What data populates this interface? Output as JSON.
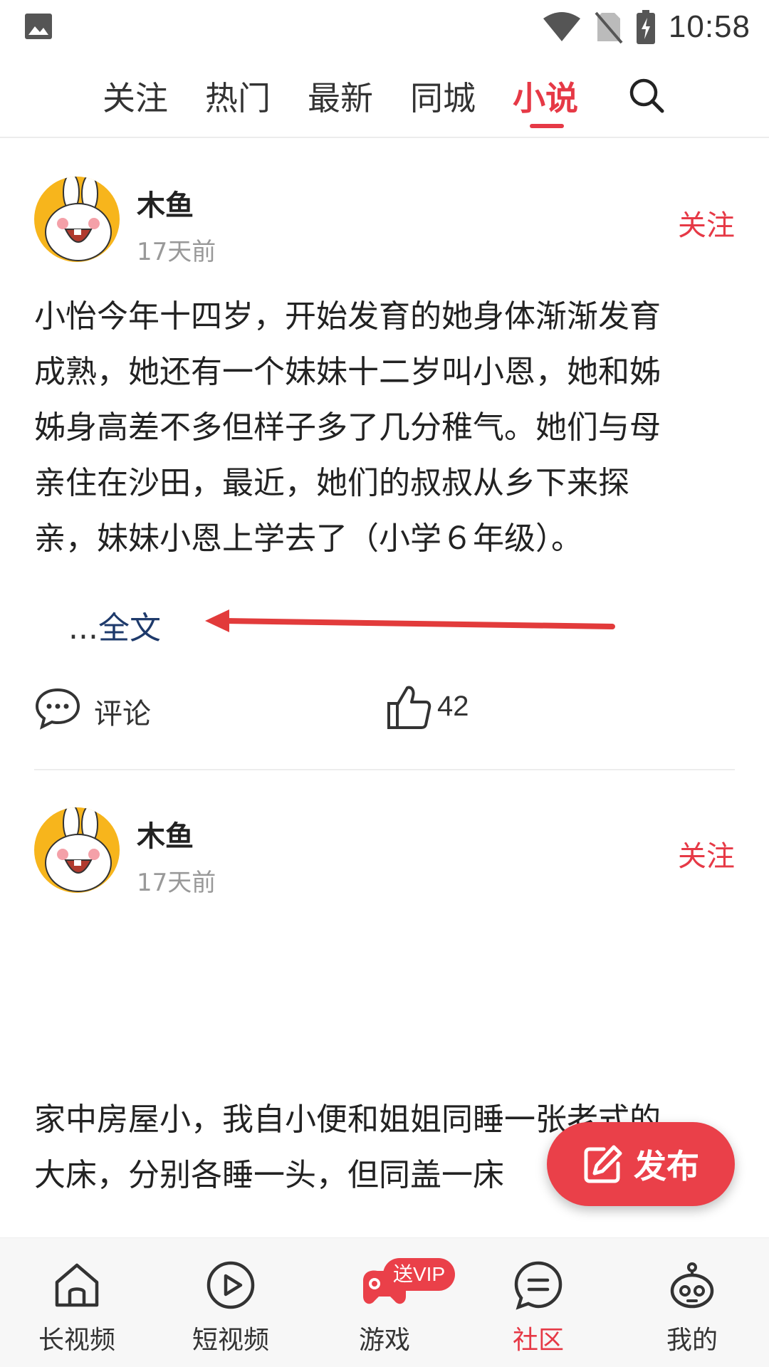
{
  "status_bar": {
    "time": "10:58",
    "icons": [
      "image-icon",
      "wifi-icon",
      "no-sim-icon",
      "battery-charging-icon"
    ]
  },
  "top_nav": {
    "tabs": [
      {
        "label": "关注"
      },
      {
        "label": "热门"
      },
      {
        "label": "最新"
      },
      {
        "label": "同城"
      },
      {
        "label": "小说"
      }
    ],
    "active_tab": "小说",
    "search_icon": "search-icon"
  },
  "posts": [
    {
      "author": "木鱼",
      "time": "17天前",
      "follow_label": "关注",
      "content_lines": [
        "小怡今年十四岁，开始发育的她身体渐渐发育",
        "成熟，她还有一个妹妹十二岁叫小恩，她和姊",
        "姊身高差不多但样子多了几分稚气。她们与母",
        "亲住在沙田，最近，她们的叔叔从乡下来探",
        "亲，妹妹小恩上学去了（小学６年级）。"
      ],
      "more_dots": "...",
      "more_label": "全文",
      "comment_label": "评论",
      "like_count": "42"
    },
    {
      "author": "木鱼",
      "time": "17天前",
      "follow_label": "关注",
      "content_lines": [
        "家中房屋小，我自小便和姐姐同睡一张老式的",
        "大床，分别各睡一头，但同盖一床"
      ]
    }
  ],
  "fab": {
    "label": "发布",
    "icon": "edit-icon"
  },
  "bottom_nav": {
    "items": [
      {
        "label": "长视频",
        "icon": "home-icon"
      },
      {
        "label": "短视频",
        "icon": "play-circle-icon"
      },
      {
        "label": "游戏",
        "icon": "gamepad-icon",
        "badge": "送VIP"
      },
      {
        "label": "社区",
        "icon": "chat-bubble-icon"
      },
      {
        "label": "我的",
        "icon": "robot-face-icon"
      }
    ],
    "active": "社区"
  },
  "colors": {
    "accent": "#e63946",
    "link": "#1e3a6b",
    "muted": "#999999"
  }
}
